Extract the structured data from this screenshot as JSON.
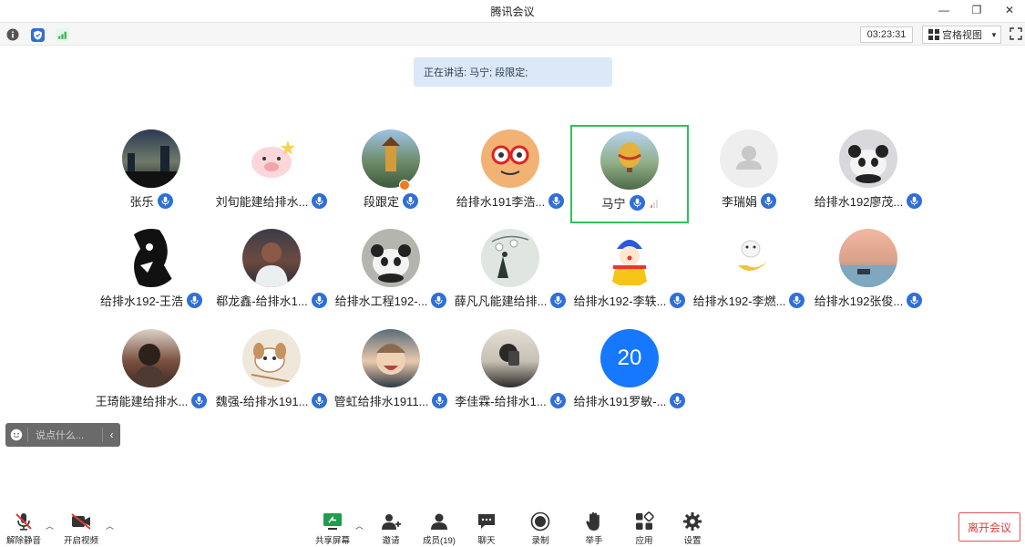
{
  "window": {
    "title": "腾讯会议"
  },
  "statusbar": {
    "timer": "03:23:31",
    "view_label": "宫格视图"
  },
  "speaking": "正在讲话: 马宁; 段限定;",
  "participants": [
    {
      "name": "张乐",
      "avatar": "photo-city",
      "bg": "#4a5a4a"
    },
    {
      "name": "刘旬能建给排水...",
      "avatar": "cartoon-pig",
      "bg": "#fff4e0"
    },
    {
      "name": "段跟定",
      "avatar": "photo-tower",
      "bg": "#6e8c6a",
      "host": true
    },
    {
      "name": "给排水191李浩...",
      "avatar": "cartoon-cookie",
      "bg": "#f4a560"
    },
    {
      "name": "马宁",
      "avatar": "photo-balloon",
      "bg": "#8fae86",
      "active": true
    },
    {
      "name": "李瑞娟",
      "avatar": "default-user",
      "bg": "#eeeeee"
    },
    {
      "name": "给排水192廖茂...",
      "avatar": "panda-toy",
      "bg": "#d8d8dd"
    },
    {
      "name": "给排水192-王浩",
      "avatar": "bw-art",
      "bg": "#111111"
    },
    {
      "name": "郗龙鑫-给排水1...",
      "avatar": "photo-player",
      "bg": "#5c3a30"
    },
    {
      "name": "给排水工程192-...",
      "avatar": "panda-photo",
      "bg": "#b5b5b0"
    },
    {
      "name": "薛凡凡能建给排...",
      "avatar": "sketch-girl",
      "bg": "#d9e2dc"
    },
    {
      "name": "给排水192-李轶...",
      "avatar": "cartoon-clown",
      "bg": "#ffffff"
    },
    {
      "name": "给排水192-李燃...",
      "avatar": "cartoon-lamp",
      "bg": "#ffffff"
    },
    {
      "name": "给排水192张俊...",
      "avatar": "photo-sunset",
      "bg": "#d9a08a"
    },
    {
      "name": "王琦能建给排水...",
      "avatar": "photo-portrait",
      "bg": "#7a5040"
    },
    {
      "name": "魏强-给排水191...",
      "avatar": "cartoon-dog",
      "bg": "#efe7da"
    },
    {
      "name": "管虹给排水1911...",
      "avatar": "photo-kid",
      "bg": "#445560"
    },
    {
      "name": "李佳霖-给排水1...",
      "avatar": "photo-mirror",
      "bg": "#c7c0b5"
    },
    {
      "name": "给排水191罗敏-...",
      "avatar": "number",
      "bg": "#1677ff",
      "number": "20"
    }
  ],
  "chat": {
    "placeholder": "说点什么..."
  },
  "toolbar": {
    "mute": "解除静音",
    "video": "开启视频",
    "share": "共享屏幕",
    "invite": "邀请",
    "members": "成员(19)",
    "chat": "聊天",
    "record": "录制",
    "hand": "举手",
    "apps": "应用",
    "settings": "设置",
    "leave": "离开会议"
  },
  "colors": {
    "accent": "#2f6fd8",
    "active_border": "#2fc05e",
    "leave": "#e03b3b"
  }
}
